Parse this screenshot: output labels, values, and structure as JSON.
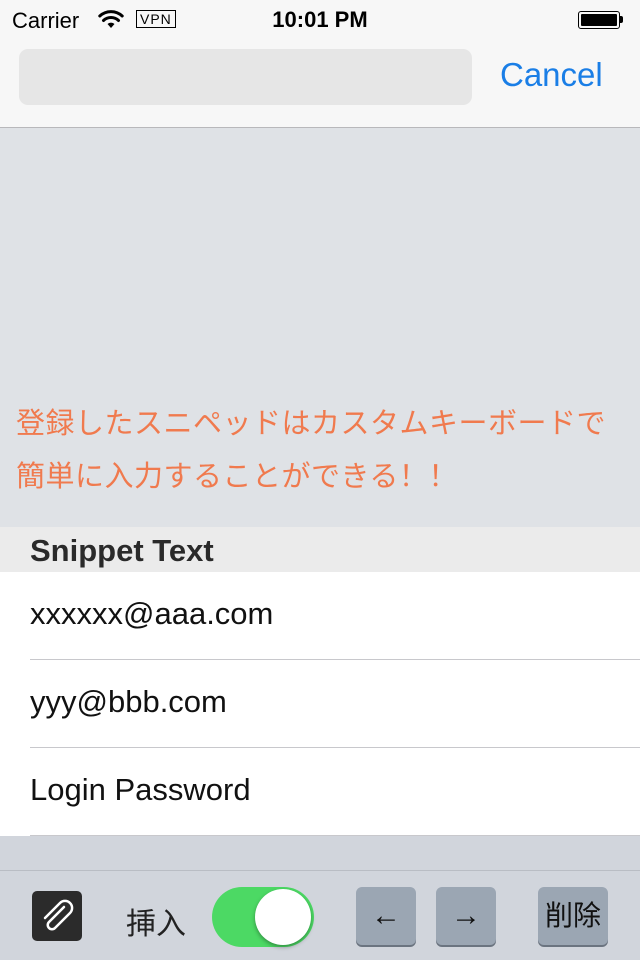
{
  "status_bar": {
    "carrier": "Carrier",
    "vpn": "VPN",
    "time": "10:01 PM",
    "icons": [
      "wifi-icon",
      "battery-icon"
    ]
  },
  "nav_bar": {
    "search_value": "",
    "cancel_label": "Cancel",
    "accent_color": "#1a7ee6"
  },
  "promo": {
    "line1": "登録したスニペッドはカスタムキーボードで",
    "line2": "簡単に入力することができる！！",
    "color": "#f07a4e"
  },
  "section": {
    "title": "Snippet Text"
  },
  "snippets": [
    "xxxxxx@aaa.com",
    "yyy@bbb.com",
    "Login Password"
  ],
  "toolbar": {
    "clip_icon": "paperclip-icon",
    "insert_label": "挿入",
    "insert_toggle_on": true,
    "toggle_color": "#4cd964",
    "left_arrow": "←",
    "right_arrow": "→",
    "delete_label": "削除"
  }
}
